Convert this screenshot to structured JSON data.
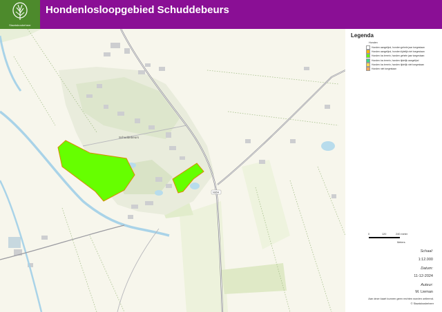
{
  "header": {
    "title": "Hondenlosloopgebied Schuddebeurs",
    "logo_text": "Staatsbosbeheer",
    "logo_icon": "tree-logo-icon",
    "background_color": "#8a0f95",
    "logo_color": "#4d8a2c"
  },
  "map": {
    "place_label": "Schuddebeurs",
    "road_label": "N654",
    "base_color": "#f7f6ec",
    "dog_area_color": "#66ff00"
  },
  "legend": {
    "title": "Legenda",
    "subtitle": "Honden",
    "items": [
      {
        "label": "Honden aangelijnd, honden gehele jaar toegestaan",
        "color": "#ffffff"
      },
      {
        "label": "Honden aangelijnd, honden tijdelijk niet toegestaan",
        "color": "#ffb400"
      },
      {
        "label": "Honden los terrein, honden gehele jaar toegestaan",
        "color": "#66ff00"
      },
      {
        "label": "Honden los terrein, honden tijdelijk aangelijnd",
        "color": "#3cd68c"
      },
      {
        "label": "Honden los terrein, honden tijdelijk niet toegestaan",
        "color": "#ffd84d"
      },
      {
        "label": "Honden niet toegestaan",
        "color": "#f2a65a"
      }
    ]
  },
  "scalebar": {
    "tick_0": "0",
    "tick_1": "120",
    "tick_2": "240 meter",
    "unit": "Meters"
  },
  "info": {
    "scale_label": "Schaal:",
    "scale_value": "1:12.000",
    "date_label": "Datum:",
    "date_value": "11-12-2024",
    "author_label": "Auteur:",
    "author_value": "M. Lieman",
    "disclaimer": "Aan deze kaart kunnen geen rechten worden ontleend.",
    "copyright": "© Staatsbosbeheer"
  }
}
